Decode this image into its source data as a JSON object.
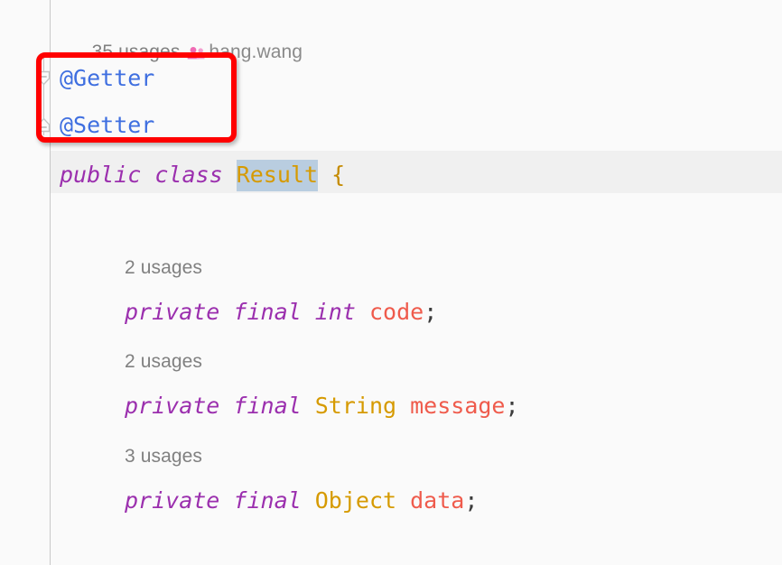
{
  "editor": {
    "background_color": "#fafafa",
    "current_line_color": "#f0f0f0",
    "gutter_divider_color": "#c8c8c8"
  },
  "header_hint": {
    "usages": "35 usages",
    "author": "hang.wang",
    "icon": "people-icon",
    "icon_color": "#f06bb4"
  },
  "annotations": [
    {
      "text": "@Getter"
    },
    {
      "text": "@Setter"
    }
  ],
  "class_declaration": {
    "modifier": "public",
    "keyword": "class",
    "name": "Result",
    "brace": "{",
    "selection_color": "#b9cde0",
    "caret_color": "#3a6fd8"
  },
  "fields": [
    {
      "usages": "2 usages",
      "modifier": "private",
      "final": "final",
      "type": "int",
      "type_is_keyword": true,
      "name": "code",
      "semicolon": ";"
    },
    {
      "usages": "2 usages",
      "modifier": "private",
      "final": "final",
      "type": "String",
      "type_is_keyword": false,
      "name": "message",
      "semicolon": ";"
    },
    {
      "usages": "3 usages",
      "modifier": "private",
      "final": "final",
      "type": "Object",
      "type_is_keyword": false,
      "name": "data",
      "semicolon": ";"
    }
  ],
  "highlight_box": {
    "color": "#ff0000",
    "label": "annotations-highlight"
  },
  "colors": {
    "keyword": "#9b2fae",
    "type": "#d69a00",
    "field": "#ef5b4c",
    "annotation": "#3f6fe0",
    "hint": "#808080",
    "punctuation": "#3b3b3b"
  }
}
